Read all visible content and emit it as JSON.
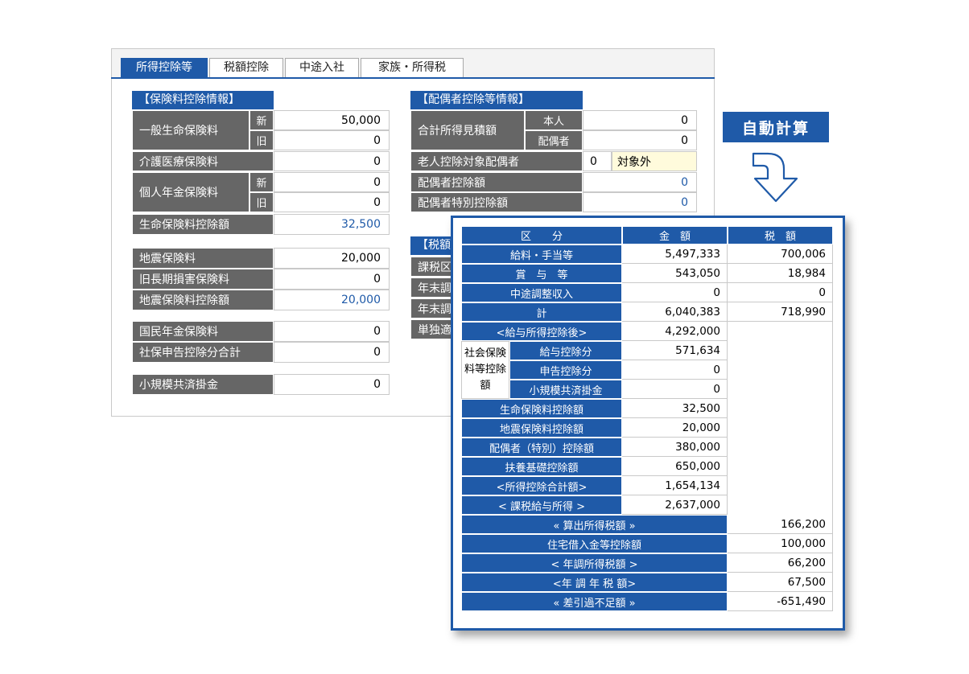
{
  "tabs": [
    "所得控除等",
    "税額控除",
    "中途入社",
    "家族・所得税"
  ],
  "insurance": {
    "header": "【保険料控除情報】",
    "general_life": {
      "label": "一般生命保険料",
      "new_label": "新",
      "new_value": "50,000",
      "old_label": "旧",
      "old_value": "0"
    },
    "nursing": {
      "label": "介護医療保険料",
      "value": "0"
    },
    "pension": {
      "label": "個人年金保険料",
      "new_label": "新",
      "new_value": "0",
      "old_label": "旧",
      "old_value": "0"
    },
    "life_deduction": {
      "label": "生命保険料控除額",
      "value": "32,500"
    },
    "earthquake": {
      "label": "地震保険料",
      "value": "20,000"
    },
    "old_long_term": {
      "label": "旧長期損害保険料",
      "value": "0"
    },
    "earthquake_deduction": {
      "label": "地震保険料控除額",
      "value": "20,000"
    },
    "national_pension": {
      "label": "国民年金保険料",
      "value": "0"
    },
    "social_total": {
      "label": "社保申告控除分合計",
      "value": "0"
    },
    "small_business": {
      "label": "小規模共済掛金",
      "value": "0"
    }
  },
  "spouse": {
    "header": "【配偶者控除等情報】",
    "income_estimate": {
      "label": "合計所得見積額",
      "self_label": "本人",
      "self_value": "0",
      "spouse_label": "配偶者",
      "spouse_value": "0"
    },
    "elderly": {
      "label": "老人控除対象配偶者",
      "value": "0",
      "status": "対象外"
    },
    "deduction": {
      "label": "配偶者控除額",
      "value": "0"
    },
    "special": {
      "label": "配偶者特別控除額",
      "value": "0"
    }
  },
  "tax_partial": {
    "header": "【税額",
    "rows": [
      "課税区",
      "年末調",
      "年末調",
      "単独適"
    ]
  },
  "badge": "自動計算",
  "result": {
    "headers": {
      "category": "区　　分",
      "amount": "金　額",
      "tax": "税　額"
    },
    "rows": [
      {
        "label": "給料・手当等",
        "amount": "5,497,333",
        "tax": "700,006"
      },
      {
        "label": "賞　与　等",
        "amount": "543,050",
        "tax": "18,984"
      },
      {
        "label": "中途調整収入",
        "amount": "0",
        "tax": "0"
      },
      {
        "label": "計",
        "amount": "6,040,383",
        "tax": "718,990"
      },
      {
        "label": "<給与所得控除後>",
        "amount": "4,292,000"
      }
    ],
    "social": {
      "group_label": "社会保険料等控除額",
      "items": [
        {
          "label": "給与控除分",
          "amount": "571,634"
        },
        {
          "label": "申告控除分",
          "amount": "0"
        },
        {
          "label": "小規模共済掛金",
          "amount": "0"
        }
      ]
    },
    "rows2": [
      {
        "label": "生命保険料控除額",
        "amount": "32,500"
      },
      {
        "label": "地震保険料控除額",
        "amount": "20,000"
      },
      {
        "label": "配偶者（特別）控除額",
        "amount": "380,000"
      },
      {
        "label": "扶養基礎控除額",
        "amount": "650,000"
      },
      {
        "label": "<所得控除合計額>",
        "amount": "1,654,134"
      },
      {
        "label": "< 課税給与所得 >",
        "amount": "2,637,000"
      }
    ],
    "tax_rows": [
      {
        "label": "« 算出所得税額 »",
        "tax": "166,200"
      },
      {
        "label": "住宅借入金等控除額",
        "tax": "100,000"
      },
      {
        "label": "< 年調所得税額 >",
        "tax": "66,200"
      },
      {
        "label": "<年 調 年 税 額>",
        "tax": "67,500"
      },
      {
        "label": "« 差引過不足額 »",
        "tax": "-651,490"
      }
    ]
  }
}
